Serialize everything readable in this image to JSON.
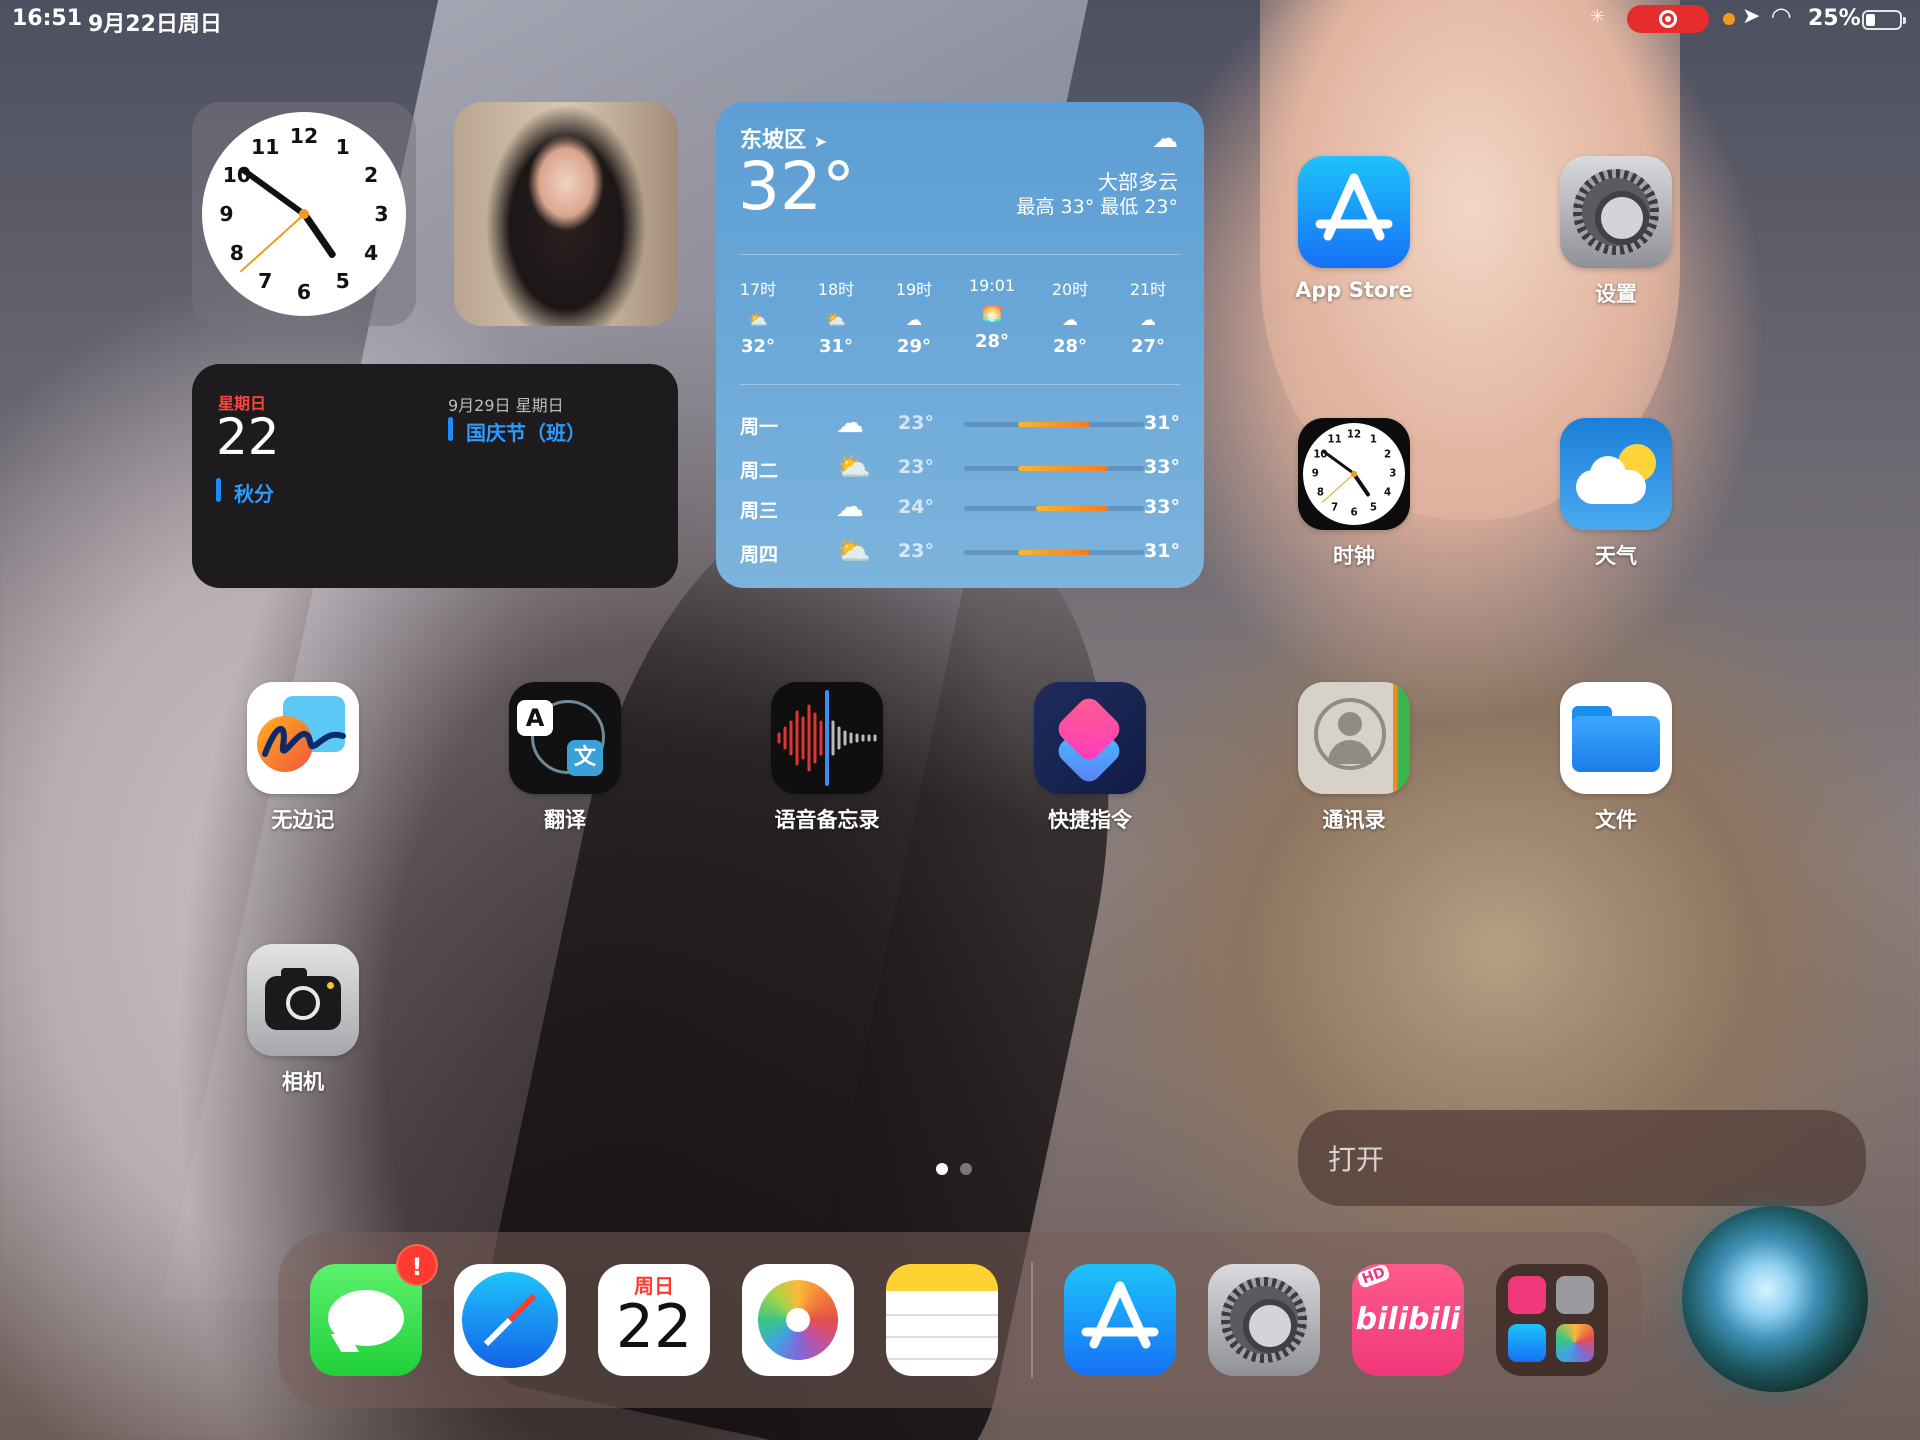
{
  "status_bar": {
    "time": "16:51",
    "date": "9月22日周日",
    "battery": "25%"
  },
  "calendar_widget": {
    "weekday": "星期日",
    "day": "22",
    "event_today": "秋分",
    "upcoming_date": "9月29日 星期日",
    "upcoming_event": "国庆节（班）"
  },
  "weather_widget": {
    "location": "东坡区",
    "temp": "32°",
    "condition": "大部多云",
    "high_low": "最高 33° 最低 23°",
    "hours": [
      {
        "time": "17时",
        "icon": "partly-cloudy-icon",
        "temp": "32°"
      },
      {
        "time": "18时",
        "icon": "partly-cloudy-icon",
        "temp": "31°"
      },
      {
        "time": "19时",
        "icon": "cloud-icon",
        "temp": "29°"
      },
      {
        "time": "19:01",
        "icon": "sunset-icon",
        "temp": "28°"
      },
      {
        "time": "20时",
        "icon": "cloud-icon",
        "temp": "28°"
      },
      {
        "time": "21时",
        "icon": "cloud-icon",
        "temp": "27°"
      }
    ],
    "days": [
      {
        "name": "周一",
        "icon": "cloud-icon",
        "low": "23°",
        "high": "31°",
        "bar_start": 0.3,
        "bar_end": 0.7
      },
      {
        "name": "周二",
        "icon": "partly-sunny-icon",
        "low": "23°",
        "high": "33°",
        "bar_start": 0.3,
        "bar_end": 0.8
      },
      {
        "name": "周三",
        "icon": "cloud-icon",
        "low": "24°",
        "high": "33°",
        "bar_start": 0.4,
        "bar_end": 0.8
      },
      {
        "name": "周四",
        "icon": "partly-sunny-icon",
        "low": "23°",
        "high": "31°",
        "bar_start": 0.3,
        "bar_end": 0.7
      }
    ]
  },
  "apps": {
    "app_store": "App Store",
    "settings": "设置",
    "clock": "时钟",
    "weather": "天气",
    "freeform": "无边记",
    "translate": "翻译",
    "voice_memos": "语音备忘录",
    "shortcuts": "快捷指令",
    "contacts": "通讯录",
    "files": "文件",
    "camera": "相机"
  },
  "siri_suggestion": "打开",
  "dock": {
    "messages_badge": "!",
    "calendar_weekday": "周日",
    "calendar_day": "22",
    "bili_label": "bilibili",
    "bili_hd": "HD"
  },
  "clock_widget": {
    "hour": 4,
    "minute": 51,
    "second": 38
  },
  "colors": {
    "accent_blue": "#1e8cff",
    "badge_red": "#ff3b30",
    "weekday_red": "#ff453a"
  }
}
